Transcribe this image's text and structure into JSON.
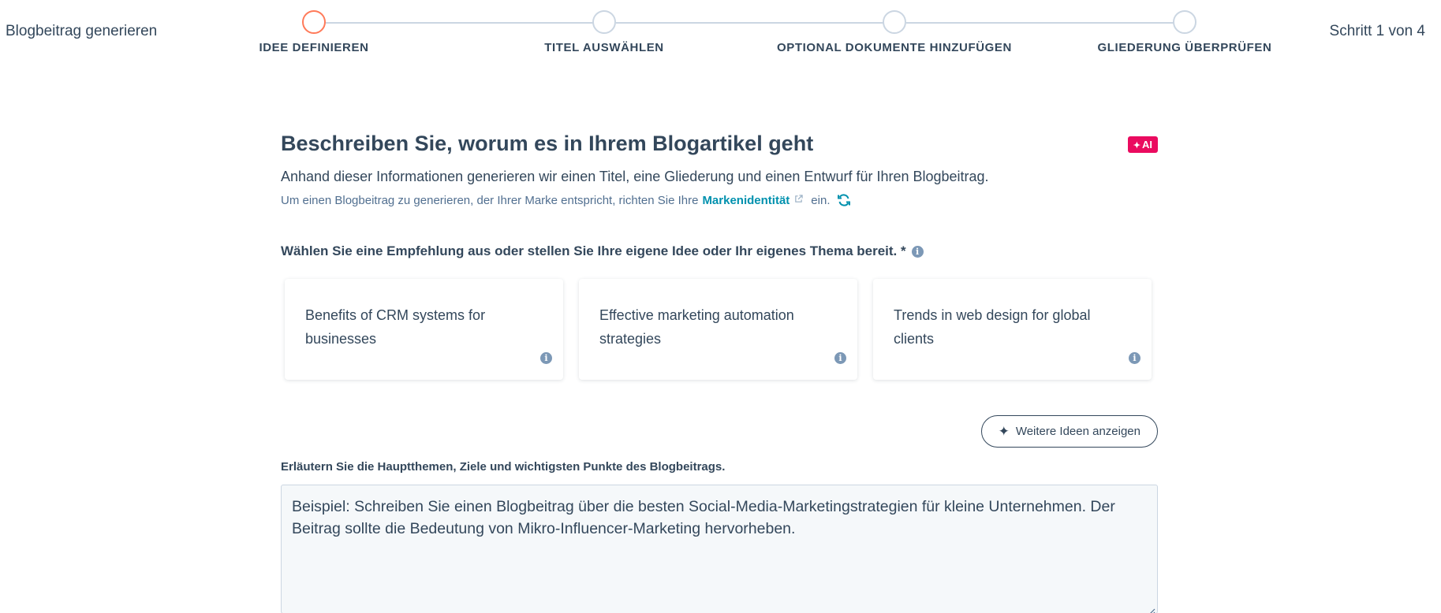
{
  "header": {
    "app_title": "Blogbeitrag generieren",
    "step_counter": "Schritt 1 von 4"
  },
  "stepper": {
    "active_index": 0,
    "active_color": "#ff7a59",
    "steps": [
      {
        "label": "IDEE DEFINIEREN"
      },
      {
        "label": "TITEL AUSWÄHLEN"
      },
      {
        "label": "OPTIONAL DOKUMENTE HINZUFÜGEN"
      },
      {
        "label": "GLIEDERUNG ÜBERPRÜFEN"
      }
    ]
  },
  "main": {
    "heading": "Beschreiben Sie, worum es in Ihrem Blogartikel geht",
    "ai_badge": "AI",
    "ai_badge_color": "#ea0b5f",
    "subtitle": "Anhand dieser Informationen generieren wir einen Titel, eine Gliederung und einen Entwurf für Ihren Blogbeitrag.",
    "brand_hint": {
      "prefix": "Um einen Blogbeitrag zu generieren, der Ihrer Marke entspricht, richten Sie Ihre",
      "link": "Markenidentität",
      "suffix": "ein."
    },
    "suggestions_label": "Wählen Sie eine Empfehlung aus oder stellen Sie Ihre eigene Idee oder Ihr eigenes Thema bereit. *",
    "suggestions": [
      {
        "text": "Benefits of CRM systems for businesses"
      },
      {
        "text": "Effective marketing automation strategies"
      },
      {
        "text": "Trends in web design for global clients"
      }
    ],
    "more_ideas_button": "Weitere Ideen anzeigen",
    "textarea_label": "Erläutern Sie die Hauptthemen, Ziele und wichtigsten Punkte des Blogbeitrags.",
    "textarea_placeholder": "Beispiel: Schreiben Sie einen Blogbeitrag über die besten Social-Media-Marketingstrategien für kleine Unternehmen. Der Beitrag sollte die Bedeutung von Mikro-Influencer-Marketing hervorheben.",
    "textarea_value": ""
  },
  "icons": {
    "info": "info-icon",
    "external_link": "external-link-icon",
    "refresh": "refresh-icon",
    "sparkle": "sparkle-icon"
  }
}
